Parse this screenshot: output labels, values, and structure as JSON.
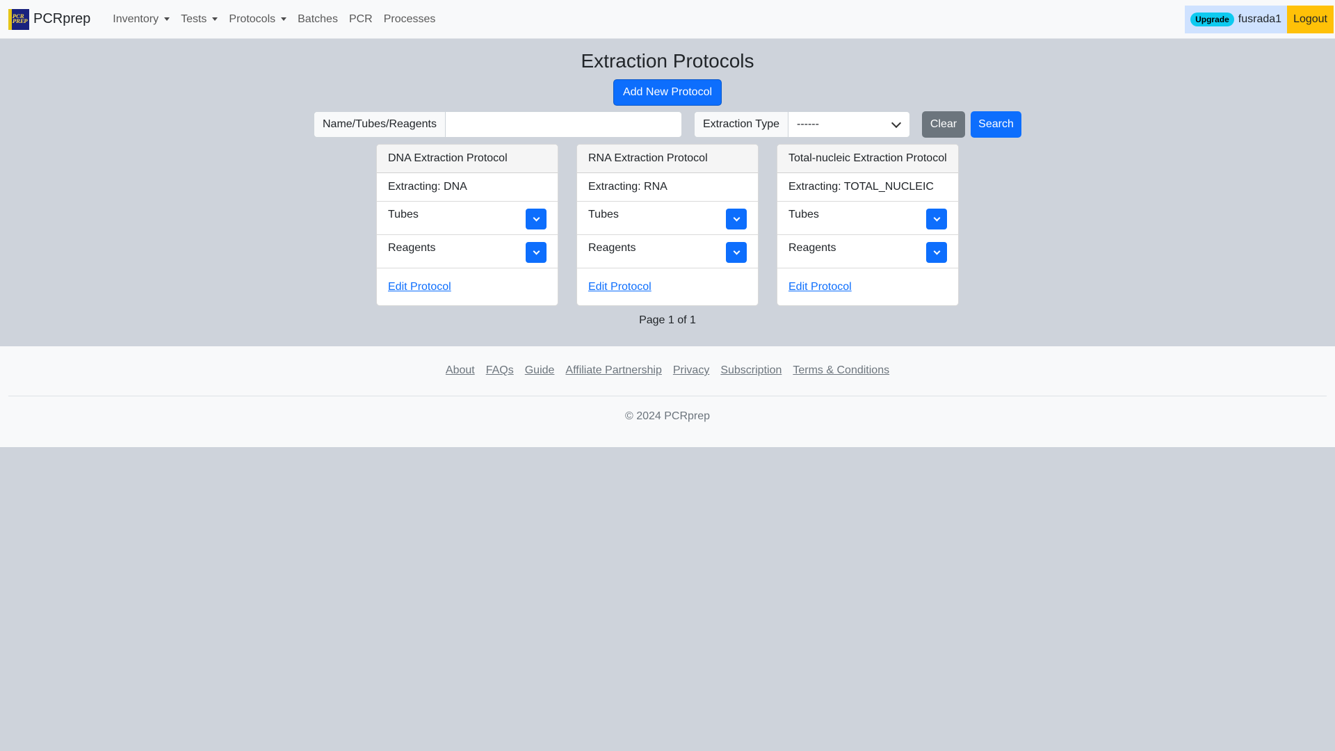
{
  "navbar": {
    "brand": "PCRprep",
    "logo_text": "PCR PREP",
    "items": [
      {
        "label": "Inventory",
        "dropdown": true
      },
      {
        "label": "Tests",
        "dropdown": true
      },
      {
        "label": "Protocols",
        "dropdown": true
      },
      {
        "label": "Batches",
        "dropdown": false
      },
      {
        "label": "PCR",
        "dropdown": false
      },
      {
        "label": "Processes",
        "dropdown": false
      }
    ],
    "upgrade_badge": "Upgrade",
    "username": "fusrada1",
    "logout": "Logout"
  },
  "main": {
    "title": "Extraction Protocols",
    "add_button": "Add New Protocol",
    "search_label": "Name/Tubes/Reagents",
    "search_value": "",
    "type_label": "Extraction Type",
    "type_selected": "------",
    "clear_button": "Clear",
    "search_button": "Search"
  },
  "cards": [
    {
      "title": "DNA Extraction Protocol",
      "extracting": "Extracting: DNA",
      "tubes": "Tubes",
      "reagents": "Reagents",
      "edit": "Edit Protocol"
    },
    {
      "title": "RNA Extraction Protocol",
      "extracting": "Extracting: RNA",
      "tubes": "Tubes",
      "reagents": "Reagents",
      "edit": "Edit Protocol"
    },
    {
      "title": "Total-nucleic Extraction Protocol",
      "extracting": "Extracting: TOTAL_NUCLEIC",
      "tubes": "Tubes",
      "reagents": "Reagents",
      "edit": "Edit Protocol"
    }
  ],
  "pagination": "Page 1 of 1",
  "footer": {
    "links": [
      "About",
      "FAQs",
      "Guide",
      "Affiliate Partnership",
      "Privacy",
      "Subscription",
      "Terms & Conditions"
    ],
    "copyright": "© 2024 PCRprep"
  },
  "colors": {
    "primary": "#0d6efd",
    "secondary": "#6c757d",
    "warning": "#ffc107",
    "info": "#0dcaf0",
    "background": "#ced3db"
  }
}
